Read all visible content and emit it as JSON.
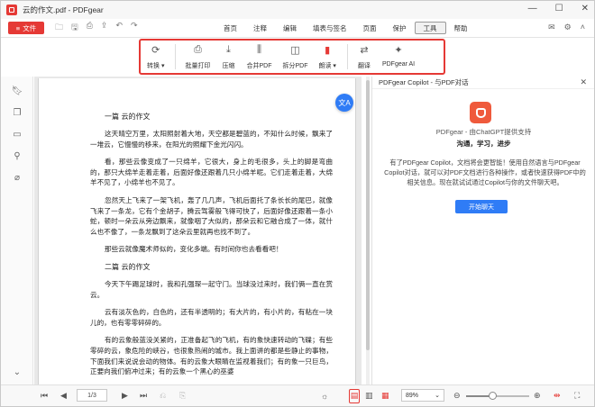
{
  "window": {
    "title": "云的作文.pdf - PDFgear"
  },
  "menubar": {
    "file_label": "文件",
    "items": [
      "首页",
      "注释",
      "编辑",
      "填表与签名",
      "页面",
      "保护",
      "工具",
      "帮助"
    ],
    "active_item": "工具"
  },
  "toolbar": {
    "tools": [
      {
        "label": "转换 ▾",
        "icon": "convert-icon"
      },
      {
        "label": "批量打印",
        "icon": "batch-print-icon"
      },
      {
        "label": "压缩",
        "icon": "compress-icon"
      },
      {
        "label": "合并PDF",
        "icon": "merge-icon"
      },
      {
        "label": "拆分PDF",
        "icon": "split-icon"
      },
      {
        "label": "朗读 ▾",
        "icon": "read-aloud-icon"
      },
      {
        "label": "翻译",
        "icon": "translate-icon"
      },
      {
        "label": "PDFgear AI",
        "icon": "ai-icon"
      }
    ]
  },
  "document": {
    "heading1": "一篇  云的作文",
    "paragraphs1": [
      "这天晴空万里，太阳照射着大地，天空都是碧蓝的，不知什么时候，飘来了一堆云，它慢慢的移来，在阳光的照耀下金光闪闪。",
      "看，那些云像变成了一只绵羊，它很大，身上的毛很多，头上的脚是弯曲的，那只大绵羊走着走着，后面好像还跟着几只小绵羊呢。它们走着走着，大绵羊不见了，小绵羊也不见了。",
      "忽然天上飞来了一架飞机，轰了几几声，飞机后面托了条长长的尾巴，就像飞来了一条龙，它有个金胡子，腾云驾雾般飞得可快了，后面好像还跟着一条小蛇，顿时一朵云从旁边飘来，就像咽了大似的，那朵云和它融合成了一体，就什么也不像了，一条龙飘到了这朵云里就再也找不到了。",
      "那些云就像魔术师似的，变化多端。有时间你也去看看吧！"
    ],
    "heading2": "二篇  云的作文",
    "paragraphs2": [
      "今天下午踢足球时，我和孔强琛一起守门。当球没过来时，我们俩一直在赏云。",
      "云有淡灰色的，白色的，还有半透明的；有大片的，有小片的，有粘在一块儿的，也有零零碎碎的。",
      "有的云象般蓝没关紧的，正准备起飞的飞机，有的象快速转动的飞碟；有些零碎的云，象危险的峡谷，也很象热闹的城市。我上面讲的都是些静止的事物，下面我们来说说会动的物体。有的云象大眼睛在监视着我们；有的象一只巨鸟，正要向我们俯冲过来；有的云象一个黑心的巫婆"
    ]
  },
  "copilot": {
    "header": "PDFgear Copilot - 与PDF对话",
    "subtitle": "PDFgear - 由ChatGPT提供支持",
    "tagline": "沟通，学习，进步",
    "description": "有了PDFgear Copilot，文档将会更智能！使用自然语言与PDFgear Copilot对话，就可以对PDF文档进行各种操作，或者快速获得PDF中的相关信息。现在就试试通过Copilot与你的文件聊天吧。",
    "start_button": "开始聊天"
  },
  "statusbar": {
    "page_indicator": "1/3",
    "zoom": "89%",
    "zoom_fraction": 0.42
  },
  "colors": {
    "brand_red": "#e53935",
    "accent_blue": "#2f7cf6"
  }
}
